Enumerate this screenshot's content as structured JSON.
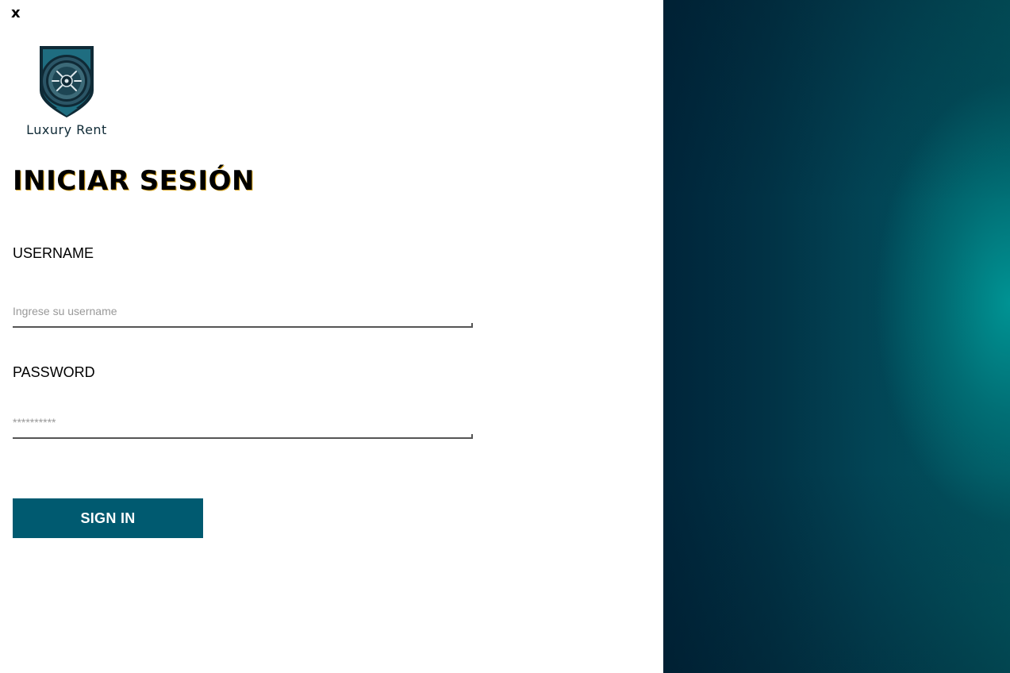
{
  "window": {
    "close_label": "x"
  },
  "brand": {
    "name": "Luxury Rent",
    "logo_icon": "shield-wheel-icon",
    "colors": {
      "shield_outer": "#0f2a36",
      "shield_inner": "#1f6d80",
      "accent": "#005a70"
    }
  },
  "login": {
    "title": "INICIAR SESIÓN",
    "username": {
      "label": "USERNAME",
      "placeholder": "Ingrese su username",
      "value": ""
    },
    "password": {
      "label": "PASSWORD",
      "placeholder": "**********",
      "value": ""
    },
    "submit_label": "SIGN IN"
  },
  "theme": {
    "button_color": "#005a70",
    "panel_gradient": [
      "#00253a",
      "#009595"
    ]
  }
}
